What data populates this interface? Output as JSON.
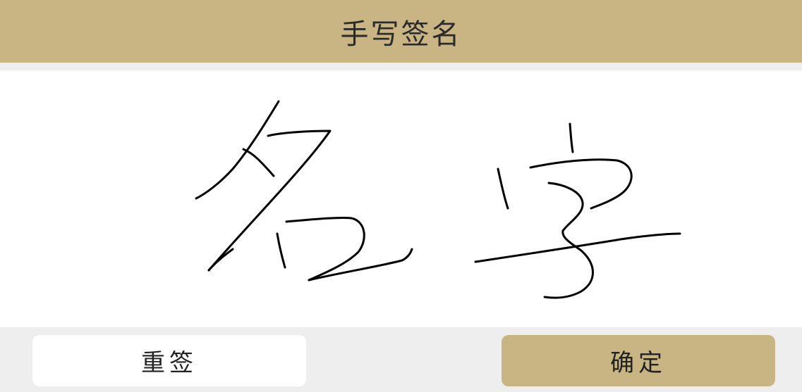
{
  "header": {
    "title": "手写签名"
  },
  "signature_pad": {
    "ink_color": "#000000",
    "background_color": "#ffffff"
  },
  "footer": {
    "resign_label": "重签",
    "confirm_label": "确定"
  },
  "colors": {
    "accent": "#c9b584",
    "page_background": "#eeeeee"
  }
}
